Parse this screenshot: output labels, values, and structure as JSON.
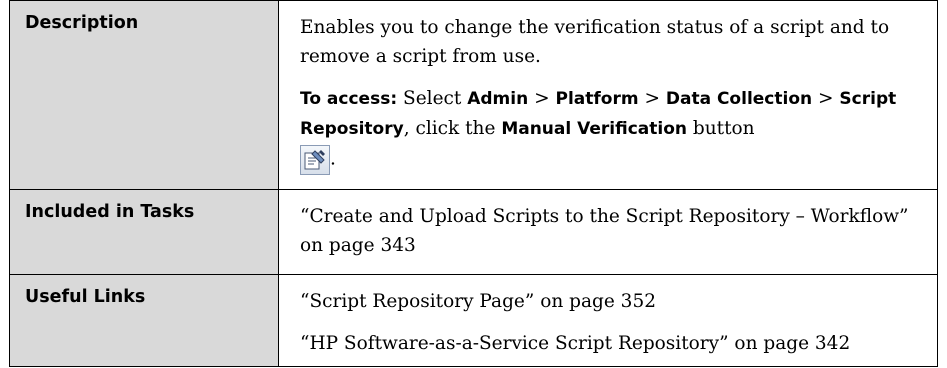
{
  "rows": [
    {
      "label": "Description",
      "description_text": "Enables you to change the verification status of a script and to remove a script from use.",
      "access": {
        "prefix": "To access:",
        "select": "Select",
        "path": [
          "Admin",
          "Platform",
          "Data Collection",
          "Script Repository"
        ],
        "separator": ">",
        "comma": ",",
        "click_the": "click the",
        "button_name": "Manual Verification",
        "button_word": "button",
        "button_icon": "manual-verification-icon",
        "trailing": "."
      }
    },
    {
      "label": "Included in Tasks",
      "links": [
        "“Create and Upload Scripts to the Script Repository – Workflow” on page 343"
      ]
    },
    {
      "label": "Useful Links",
      "links": [
        "“Script Repository Page” on page 352",
        "“HP Software-as-a-Service Script Repository” on page 342"
      ]
    }
  ]
}
